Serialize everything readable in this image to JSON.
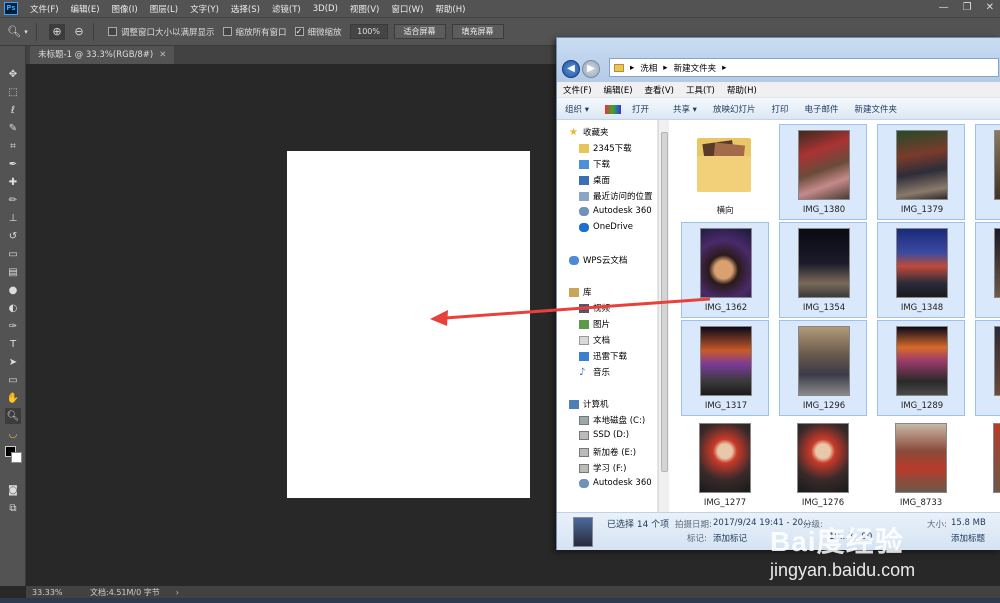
{
  "photoshop": {
    "menu": [
      "文件(F)",
      "编辑(E)",
      "图像(I)",
      "图层(L)",
      "文字(Y)",
      "选择(S)",
      "滤镜(T)",
      "3D(D)",
      "视图(V)",
      "窗口(W)",
      "帮助(H)"
    ],
    "options": {
      "resize_windows": "调整窗口大小以满屏显示",
      "zoom_all": "缩放所有窗口",
      "scrubby_zoom": "细微缩放",
      "zoom_value": "100%",
      "fit_screen": "适合屏幕",
      "fill_screen": "填充屏幕"
    },
    "doc_tab": "未标题-1 @ 33.3%(RGB/8#)",
    "status": {
      "zoom": "33.33%",
      "doc_size": "文档:4.51M/0 字节"
    }
  },
  "explorer": {
    "breadcrumb": [
      "▸",
      "洗相",
      "▸",
      "新建文件夹",
      "▸"
    ],
    "menu": [
      "文件(F)",
      "编辑(E)",
      "查看(V)",
      "工具(T)",
      "帮助(H)"
    ],
    "commands": [
      "组织 ▾",
      "打开",
      "共享 ▾",
      "放映幻灯片",
      "打印",
      "电子邮件",
      "新建文件夹"
    ],
    "nav": {
      "favorites": "收藏夹",
      "fav_items": [
        "2345下载",
        "下载",
        "桌面",
        "最近访问的位置",
        "Autodesk 360",
        "OneDrive"
      ],
      "wps": "WPS云文档",
      "library": "库",
      "lib_items": [
        "视频",
        "图片",
        "文档",
        "迅雷下载",
        "音乐"
      ],
      "computer": "计算机",
      "drives": [
        "本地磁盘 (C:)",
        "SSD (D:)",
        "新加卷 (E:)",
        "学习 (F:)",
        "Autodesk 360"
      ]
    },
    "files": [
      {
        "name": "横向",
        "kind": "folder"
      },
      {
        "name": "IMG_1380",
        "kind": "image"
      },
      {
        "name": "IMG_1379",
        "kind": "image"
      },
      {
        "name": "IMG_1362",
        "kind": "image"
      },
      {
        "name": "IMG_1354",
        "kind": "image"
      },
      {
        "name": "IMG_1348",
        "kind": "image"
      },
      {
        "name": "IMG_1317",
        "kind": "image"
      },
      {
        "name": "IMG_1296",
        "kind": "image"
      },
      {
        "name": "IMG_1289",
        "kind": "image"
      },
      {
        "name": "IMG_1277",
        "kind": "image"
      },
      {
        "name": "IMG_1276",
        "kind": "image"
      },
      {
        "name": "IMG_8733",
        "kind": "image"
      }
    ],
    "details": {
      "selected": "已选择 14 个项",
      "date_label": "拍摄日期:",
      "date_value": "2017/9/24 19:41 - 20...",
      "rating_label": "分级:",
      "tags_label": "标记:",
      "tags_value": "添加标记",
      "size_label": "大小:",
      "size_value": "15.8 MB",
      "title_value": "添加标题",
      "dims_partial": "10...3...90"
    }
  },
  "watermark": {
    "brand": "Bai度经验",
    "site": "jingyan.baidu.com"
  },
  "colors": {
    "accent_arrow": "#e8413c",
    "ps_bg": "#535353"
  }
}
